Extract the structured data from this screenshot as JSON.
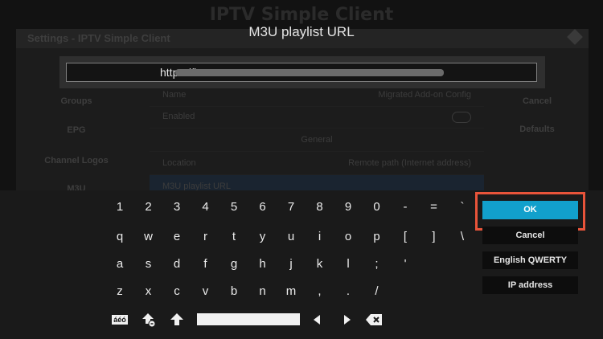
{
  "background": {
    "addon_title": "IPTV Simple Client",
    "settings_title": "Settings - IPTV Simple Client",
    "sidebar": [
      "Groups",
      "EPG",
      "Channel Logos",
      "M3U"
    ],
    "rows": [
      {
        "label": "Name",
        "value": "Migrated Add-on Config"
      },
      {
        "label": "Enabled",
        "value": ""
      },
      {
        "label": "",
        "value": "General"
      },
      {
        "label": "Location",
        "value": "Remote path (Internet address)"
      },
      {
        "label": "M3U playlist URL",
        "value": ""
      }
    ],
    "right_buttons": [
      "Cancel",
      "Defaults"
    ]
  },
  "dialog": {
    "title": "M3U playlist URL",
    "url_value": "https://i"
  },
  "keyboard": {
    "rows": [
      [
        "1",
        "2",
        "3",
        "4",
        "5",
        "6",
        "7",
        "8",
        "9",
        "0",
        "-",
        "=",
        "`"
      ],
      [
        "q",
        "w",
        "e",
        "r",
        "t",
        "y",
        "u",
        "i",
        "o",
        "p",
        "[",
        "]",
        "\\"
      ],
      [
        "a",
        "s",
        "d",
        "f",
        "g",
        "h",
        "j",
        "k",
        "l",
        ";",
        "'"
      ],
      [
        "z",
        "x",
        "c",
        "v",
        "b",
        "n",
        "m",
        ",",
        ".",
        "/"
      ]
    ],
    "symbols_label": "áéó",
    "buttons": {
      "ok": "OK",
      "cancel": "Cancel",
      "layout": "English QWERTY",
      "ip": "IP address"
    }
  },
  "colors": {
    "accent": "#12a0cc",
    "highlight": "#e8543a"
  }
}
